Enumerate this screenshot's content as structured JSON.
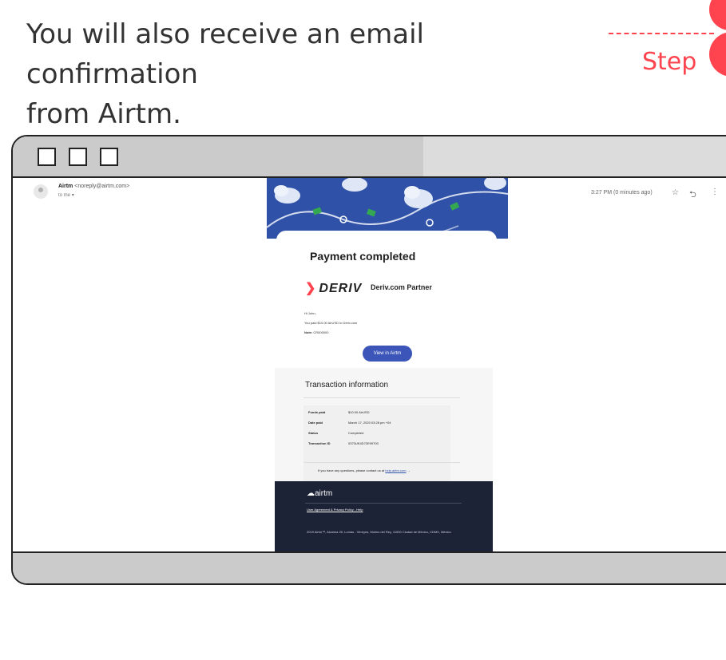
{
  "intro": {
    "line1": "You will also receive an email confirmation",
    "line2": "from Airtm."
  },
  "step": {
    "label": "Step"
  },
  "colors": {
    "accent": "#ff444f",
    "brand_blue": "#3b56b8",
    "footer_bg": "#1c2337"
  },
  "email": {
    "sender_name": "Airtm",
    "sender_email": "<noreply@airtm.com>",
    "to": "to me",
    "time": "3:27 PM (0 minutes ago)",
    "icons": {
      "star": "star-icon",
      "reply": "reply-icon",
      "more": "more-vertical-icon"
    },
    "title": "Payment completed",
    "brand": "DERIV",
    "partner": "Deriv.com Partner",
    "greeting": "Hi John,",
    "paid_text": "You paid $10.00 AirUSD to Deriv.com",
    "note_label": "Note:",
    "note_value": "CR000000",
    "view_button": "View in Airtm",
    "transaction": {
      "title": "Transaction information",
      "rows": [
        {
          "label": "Funds paid",
          "value": "$10.00 AirUSD"
        },
        {
          "label": "Date paid",
          "value": "March 17, 2020 03:28 pm +04"
        },
        {
          "label": "Status",
          "value": "Completed"
        },
        {
          "label": "Transaction ID",
          "value": "0373UK4D72E99700"
        }
      ],
      "contact_text": "If you have any questions, please contact us at",
      "contact_link": "help.airtm.com",
      "contact_arrow": "→"
    },
    "footer": {
      "logo": "airtm",
      "links": "User Agreement & Privacy Policy - Help",
      "address": "2019 Airtm™, Alcaima 25, Lomas - Virreyes, Molino del Rey, 11000 Ciudad de México, CDMX, México"
    }
  }
}
